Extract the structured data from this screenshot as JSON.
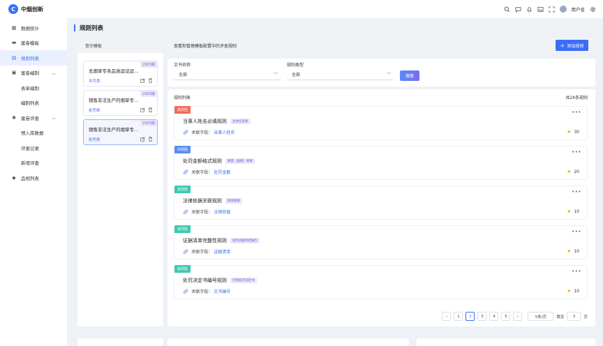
{
  "header": {
    "logo_text": "中烟创新",
    "username": "用户名",
    "icons": [
      "search-icon",
      "chat-icon",
      "bell-icon",
      "image-icon",
      "fullscreen-icon",
      "avatar",
      "gear-icon"
    ]
  },
  "sidebar": {
    "items": [
      {
        "label": "数据统计",
        "icon": "dashboard-icon",
        "type": "top"
      },
      {
        "label": "案卷模板",
        "icon": "folder-icon",
        "type": "top"
      },
      {
        "label": "规则列表",
        "icon": "list-icon",
        "type": "top",
        "active": true
      },
      {
        "label": "案卷编制",
        "icon": "edit-icon",
        "type": "group",
        "expanded": true
      },
      {
        "label": "表单编制",
        "type": "sub"
      },
      {
        "label": "编制列表",
        "type": "sub"
      },
      {
        "label": "案卷评查",
        "icon": "review-icon",
        "type": "group",
        "expanded": true
      },
      {
        "label": "预入库数据",
        "type": "sub"
      },
      {
        "label": "评查记录",
        "type": "sub"
      },
      {
        "label": "新增评查",
        "type": "sub"
      },
      {
        "label": "品规列表",
        "icon": "diamond-icon",
        "type": "top"
      }
    ]
  },
  "page": {
    "title": "规则列表"
  },
  "templates": {
    "header": "卷宗模板",
    "items": [
      {
        "title": "无烟草专卖品准运证运...",
        "type": "许可类",
        "year": "2023版"
      },
      {
        "title": "销售非法生产的烟草专...",
        "type": "处罚类",
        "year": "2023版"
      },
      {
        "title": "销售非法生产的烟草专...",
        "type": "处罚类",
        "year": "2023版",
        "active": true
      }
    ]
  },
  "main": {
    "header_text": "查看和管理模板配置中的评查规则",
    "add_button": "添加规则",
    "filters": {
      "doc_name_label": "文书名称",
      "doc_name_value": "全部",
      "rule_type_label": "规则类型",
      "rule_type_value": "全部",
      "search_button": "搜索"
    },
    "list_title": "规则列表",
    "total": "共24条规则",
    "field_label": "关联字段：",
    "rules": [
      {
        "risk": "高风险",
        "risk_color": "#f26b5b",
        "name": "当事人姓名必填规则",
        "badge": "主体信息类",
        "field": "当事人姓名",
        "score": "30"
      },
      {
        "risk": "中风险",
        "risk_color": "#5b8ef0",
        "name": "处罚金额格式规则",
        "badge": "数量（金额）要素",
        "field": "处罚金额",
        "score": "20"
      },
      {
        "risk": "低风险",
        "risk_color": "#3ec9ae",
        "name": "法律依据关联规则",
        "badge": "期间要素",
        "field": "法律依据",
        "score": "10"
      },
      {
        "risk": "低风险",
        "risk_color": "#3ec9ae",
        "name": "证据清单完整性规则",
        "badge": "案件调查终结报告",
        "field": "证据清单",
        "score": "10"
      },
      {
        "risk": "低风险",
        "risk_color": "#3ec9ae",
        "name": "处罚决定书编号规则",
        "badge": "行政处罚决定书",
        "field": "文书编号",
        "score": "10"
      }
    ],
    "pagination": {
      "pages": [
        "1",
        "2",
        "3",
        "4",
        "5"
      ],
      "current": "2",
      "page_size": "5条/页",
      "jump_label": "跳至",
      "jump_value": "3",
      "page_suffix": "页"
    }
  },
  "colors": {
    "primary": "#3b6ef5",
    "high_risk": "#f26b5b",
    "mid_risk": "#5b8ef0",
    "low_risk": "#3ec9ae",
    "star": "#f5a623"
  }
}
